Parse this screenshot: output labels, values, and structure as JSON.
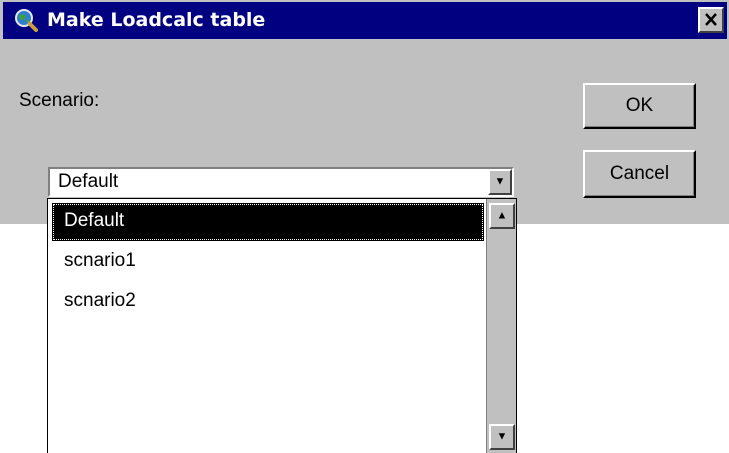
{
  "window": {
    "title": "Make Loadcalc table",
    "close_glyph": "✕"
  },
  "form": {
    "scenario_label": "Scenario:"
  },
  "buttons": {
    "ok_label": "OK",
    "cancel_label": "Cancel"
  },
  "combo": {
    "value": "Default",
    "arrow_glyph": "▼"
  },
  "dropdown": {
    "options": [
      {
        "label": "Default",
        "selected": true
      },
      {
        "label": "scnario1",
        "selected": false
      },
      {
        "label": "scnario2",
        "selected": false
      }
    ],
    "scroll_up_glyph": "▲",
    "scroll_down_glyph": "▼"
  },
  "colors": {
    "titlebar": "#000080",
    "face": "#c0c0c0",
    "selection": "#000000"
  },
  "icons": {
    "app": "globe-magnifier-icon"
  }
}
